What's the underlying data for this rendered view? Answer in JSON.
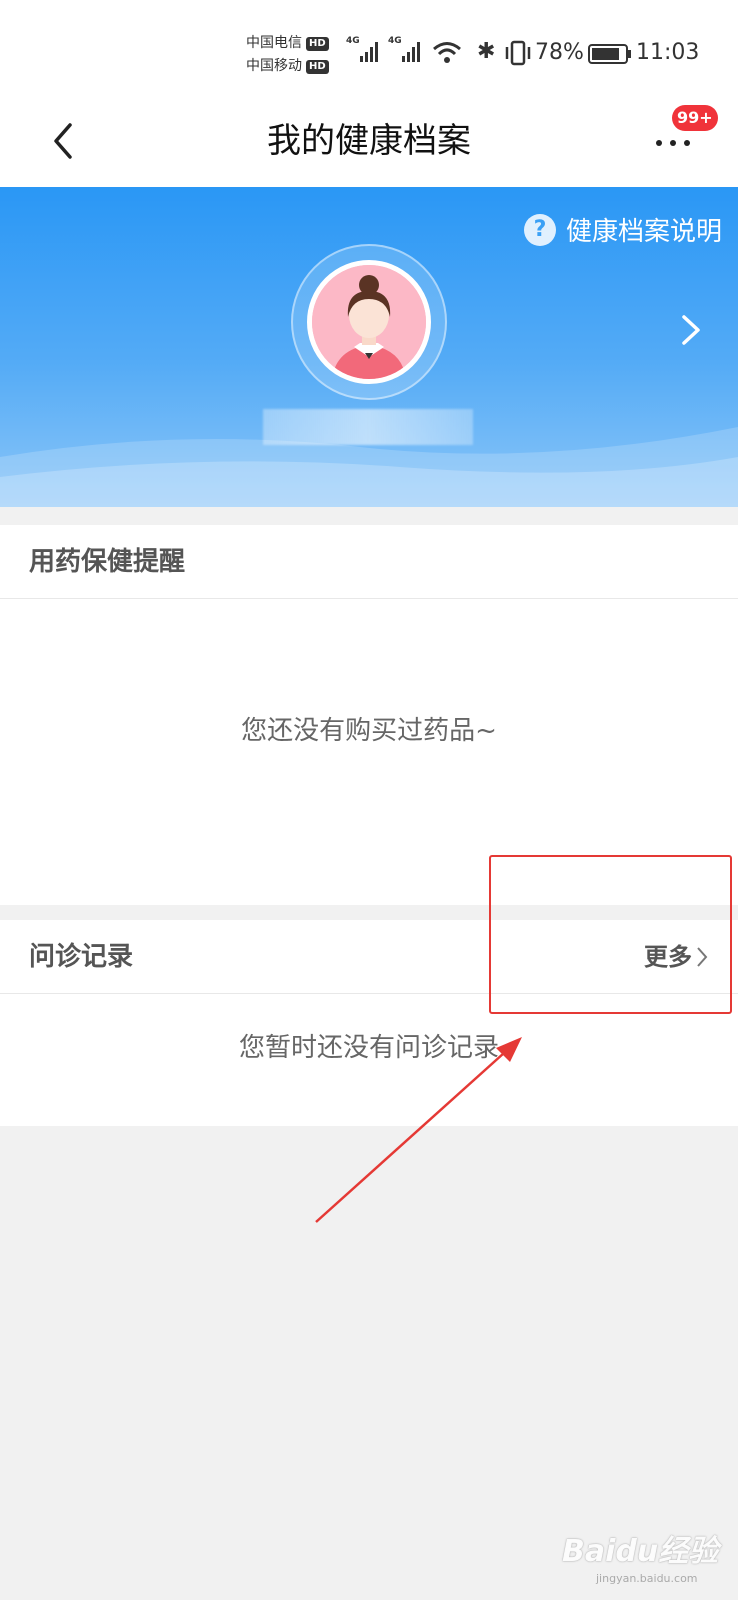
{
  "status_bar": {
    "carrier_1": "中国电信",
    "carrier_2": "中国移动",
    "hd_label": "HD",
    "network_1": "4G",
    "network_2": "4G",
    "battery": "78%",
    "time": "11:03"
  },
  "nav": {
    "title": "我的健康档案",
    "badge": "99+"
  },
  "banner": {
    "help_icon_glyph": "?",
    "help_label": "健康档案说明"
  },
  "medication_section": {
    "title": "用药保健提醒",
    "empty_text": "您还没有购买过药品~"
  },
  "consultation_section": {
    "title": "问诊记录",
    "more_label": "更多",
    "empty_text": "您暂时还没有问诊记录"
  },
  "watermark": {
    "brand": "Baidu经验",
    "url": "jingyan.baidu.com"
  },
  "colors": {
    "banner_top": "#2a97f5",
    "badge": "#f0333a",
    "annotation": "#e53935"
  }
}
